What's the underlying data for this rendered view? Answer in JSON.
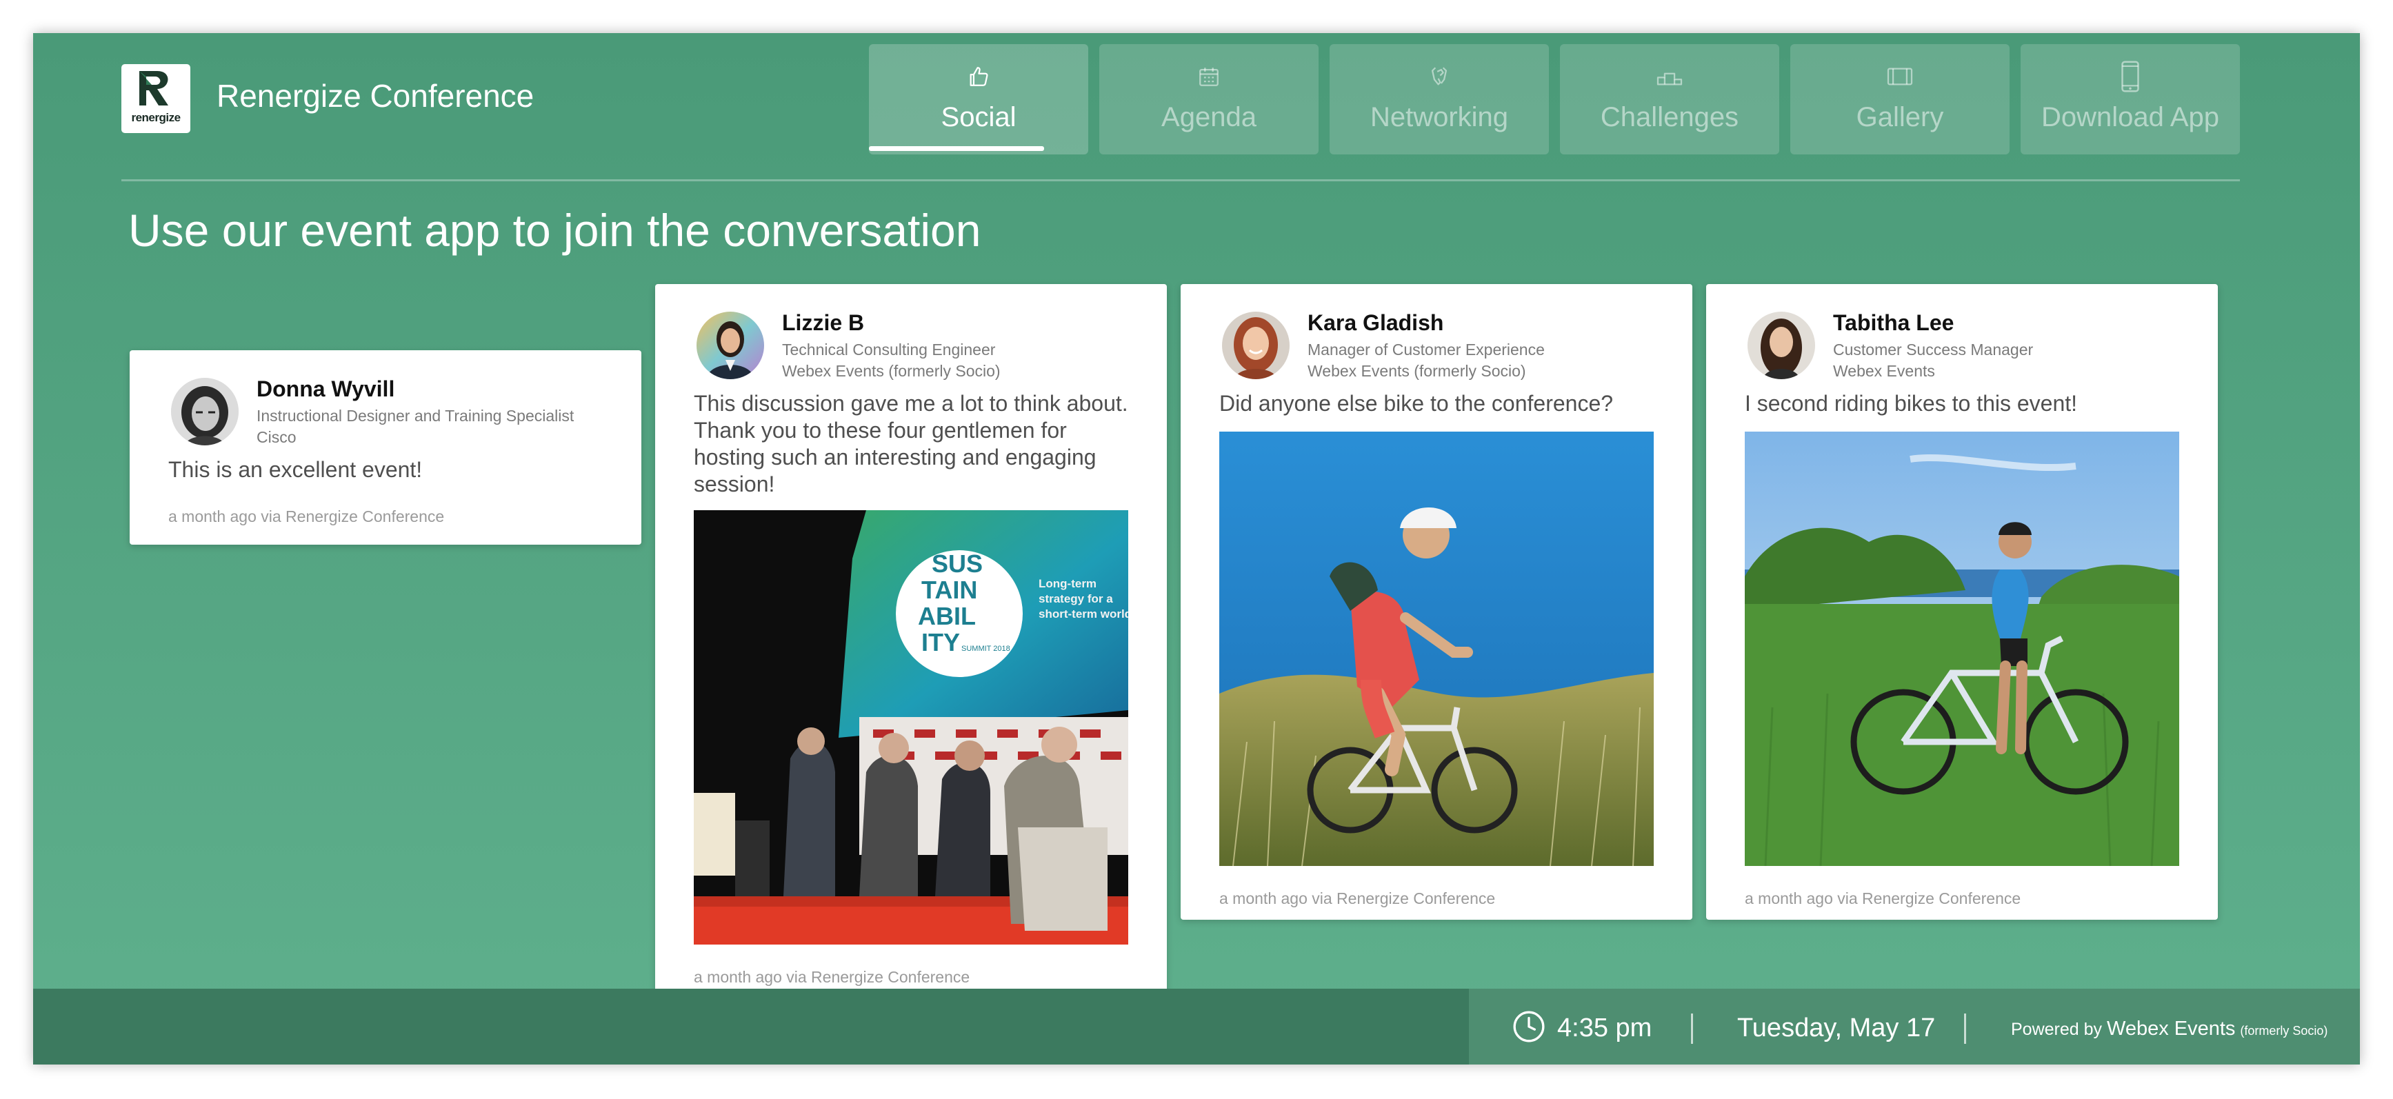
{
  "header": {
    "brand_title": "Renergize Conference",
    "logo_text": "renergize"
  },
  "nav": {
    "tabs": [
      {
        "label": "Social",
        "icon": "thumbs-up-icon",
        "active": true
      },
      {
        "label": "Agenda",
        "icon": "calendar-icon",
        "active": false
      },
      {
        "label": "Networking",
        "icon": "handshake-icon",
        "active": false
      },
      {
        "label": "Challenges",
        "icon": "podium-icon",
        "active": false
      },
      {
        "label": "Gallery",
        "icon": "gallery-icon",
        "active": false
      },
      {
        "label": "Download App",
        "icon": "mobile-phone-icon",
        "active": false
      }
    ]
  },
  "headline": "Use our event app to join the conversation",
  "posts": [
    {
      "author": "Donna Wyvill",
      "title": "Instructional Designer and Training Specialist",
      "company": "Cisco",
      "text": "This is an excellent event!",
      "footer": "a month ago via Renergize Conference"
    },
    {
      "author": "Lizzie B",
      "title": "Technical Consulting Engineer",
      "company": "Webex Events (formerly Socio)",
      "text": "This discussion gave me a lot to think about. Thank you to these four gentlemen for hosting such an interesting and engaging session!",
      "footer": "a month ago via Renergize Conference",
      "photo_sign_lines": [
        "SUS",
        "TAIN",
        "ABIL",
        "ITY"
      ],
      "photo_sign_sub": "SUMMIT 2018",
      "photo_banner_lines": [
        "Long-term",
        "strategy for a",
        "short-term world"
      ]
    },
    {
      "author": "Kara Gladish",
      "title": "Manager of Customer Experience",
      "company": "Webex Events (formerly Socio)",
      "text": "Did anyone else bike to the conference?",
      "footer": "a month ago via Renergize Conference"
    },
    {
      "author": "Tabitha Lee",
      "title": "Customer Success Manager",
      "company": "Webex Events",
      "text": "I second riding bikes to this event!",
      "footer": "a month ago via Renergize Conference"
    }
  ],
  "status_bar": {
    "time": "4:35 pm",
    "date": "Tuesday, May 17",
    "powered_prefix": "Powered by",
    "powered_brand": "Webex Events",
    "powered_suffix": "(formerly Socio)"
  },
  "colors": {
    "background_top": "#4a9a78",
    "background_bottom": "#5fb08d",
    "bottom_bar": "#3c7a5f",
    "info_panel": "#4e8e71"
  }
}
